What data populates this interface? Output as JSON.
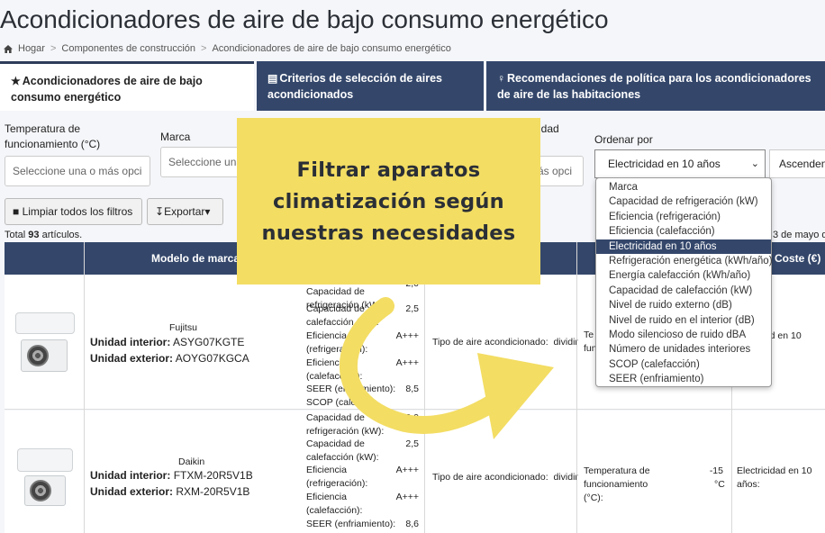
{
  "page": {
    "title": "Acondicionadores de aire de bajo consumo energético",
    "breadcrumb": [
      "Hogar",
      "Componentes de construcción",
      "Acondicionadores de aire de bajo consumo energético"
    ]
  },
  "tabs": [
    {
      "label": "Acondicionadores de aire de bajo consumo energético",
      "icon": "star-icon",
      "active": true
    },
    {
      "label": "Criterios de selección de aires acondicionados",
      "icon": "book-icon",
      "active": false
    },
    {
      "label": "Recomendaciones de política para los acondicionadores de aire de las habitaciones",
      "icon": "lightbulb-icon",
      "active": false
    }
  ],
  "filters": {
    "temperature": {
      "label": "Temperatura de funcionamiento (°C)",
      "placeholder": "Seleccione una o más opci"
    },
    "brand": {
      "label": "Marca",
      "placeholder": "Seleccione una"
    },
    "third": {
      "label_fragment": "idad",
      "placeholder_fragment": "ás opci"
    },
    "sort": {
      "label": "Ordenar por",
      "value": "Electricidad en 10 años"
    },
    "order": {
      "value": "Ascenden"
    }
  },
  "buttons": {
    "clear": "Limpiar todos los filtros",
    "export": "Exportar"
  },
  "results": {
    "total_prefix": "Total ",
    "total_count": "93",
    "total_suffix": " artículos.",
    "date_fragment": "3 de mayo d"
  },
  "table": {
    "headers": {
      "model": "Modelo de marca",
      "cost": "Coste (€)"
    },
    "rows": [
      {
        "brand": "Fujitsu",
        "indoor_label": "Unidad interior:",
        "indoor": "ASYG07KGTE",
        "outdoor_label": "Unidad exterior:",
        "outdoor": "AOYG07KGCA",
        "specs": [
          {
            "label": "Capacidad de refrigeración (kW):",
            "value": "2,0"
          },
          {
            "label": "Capacidad de calefacción (kW):",
            "value": "2,5"
          },
          {
            "label": "Eficiencia (refrigeración):",
            "value": "A+++"
          },
          {
            "label": "Eficiencia (calefacción):",
            "value": "A+++"
          },
          {
            "label": "SEER (enfriamiento):",
            "value": "8,5"
          },
          {
            "label": "SCOP (calefa",
            "value": ""
          }
        ],
        "type_label": "Tipo de aire acondicionado:",
        "type_value": "dividir",
        "temp_fragment": "Te\nfunc",
        "cost_fragment": "dad en 10"
      },
      {
        "brand": "Daikin",
        "indoor_label": "Unidad interior:",
        "indoor": "FTXM-20R5V1B",
        "outdoor_label": "Unidad exterior:",
        "outdoor": "RXM-20R5V1B",
        "specs": [
          {
            "label": "Capacidad de refrigeración (kW):",
            "value": "2,0"
          },
          {
            "label": "Capacidad de calefacción (kW):",
            "value": "2,5"
          },
          {
            "label": "Eficiencia (refrigeración):",
            "value": "A+++"
          },
          {
            "label": "Eficiencia (calefacción):",
            "value": "A+++"
          },
          {
            "label": "SEER (enfriamiento):",
            "value": "8,6"
          }
        ],
        "type_label": "Tipo de aire acondicionado:",
        "type_value": "dividir",
        "temp_label": "Temperatura de funcionamiento (°C):",
        "temp_value": "-15",
        "temp_unit": "°C",
        "cost_label": "Electricidad en 10 años:"
      }
    ]
  },
  "dropdown_options": [
    "Marca",
    "Capacidad de refrigeración (kW)",
    "Eficiencia (refrigeración)",
    "Eficiencia (calefacción)",
    "Electricidad en 10 años",
    "Refrigeración energética (kWh/año)",
    "Energía calefacción (kWh/año)",
    "Capacidad de calefacción (kW)",
    "Nivel de ruido externo (dB)",
    "Nivel de ruido en el interior (dB)",
    "Modo silencioso de ruido dBA",
    "Número de unidades interiores",
    "SCOP (calefacción)",
    "SEER (enfriamiento)"
  ],
  "dropdown_selected": "Electricidad en 10 años",
  "overlay": {
    "text_line1": "Filtrar aparatos",
    "text_line2": "climatización según",
    "text_line3": "nuestras necesidades",
    "color": "#f3dd63"
  },
  "colors": {
    "header_navy": "#34476b",
    "overlay_yellow": "#f3dd63"
  }
}
